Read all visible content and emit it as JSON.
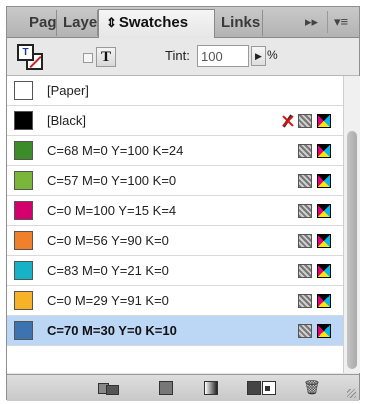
{
  "tabs": [
    {
      "label": "Pages"
    },
    {
      "label": "Layers"
    },
    {
      "label": "Swatches",
      "icon": "swatches-arrows-icon"
    },
    {
      "label": "Links"
    }
  ],
  "panel_controls": {
    "collapse": "▸▸",
    "menu": "▾≡"
  },
  "controls": {
    "fill_stroke_glyph": "T",
    "text_toggle_glyph": "T",
    "tint_label": "Tint:",
    "tint_value": "100",
    "tint_arrow": "▶",
    "percent": "%"
  },
  "swatches": [
    {
      "name": "[Paper]",
      "color": "#ffffff",
      "non_editable": false,
      "show_icons": false
    },
    {
      "name": "[Black]",
      "color": "#000000",
      "non_editable": true,
      "show_icons": true
    },
    {
      "name": "C=68 M=0 Y=100 K=24",
      "color": "#3c8c2a",
      "show_icons": true
    },
    {
      "name": "C=57 M=0 Y=100 K=0",
      "color": "#7ab63a",
      "show_icons": true
    },
    {
      "name": "C=0 M=100 Y=15 K=4",
      "color": "#d4006e",
      "show_icons": true
    },
    {
      "name": "C=0 M=56 Y=90 K=0",
      "color": "#f0802a",
      "show_icons": true
    },
    {
      "name": "C=83 M=0 Y=21 K=0",
      "color": "#16b2c8",
      "show_icons": true
    },
    {
      "name": "C=0 M=29 Y=91 K=0",
      "color": "#f8b228",
      "show_icons": true
    },
    {
      "name": "C=70 M=30 Y=0 K=10",
      "color": "#3d73b0",
      "show_icons": true,
      "selected": true
    }
  ],
  "bottom_icons": [
    "show-swatches-icon",
    "new-color-group-icon",
    "gradient-swatch-icon",
    "swatch-group-icon",
    "new-swatch-icon",
    "trash-icon"
  ]
}
